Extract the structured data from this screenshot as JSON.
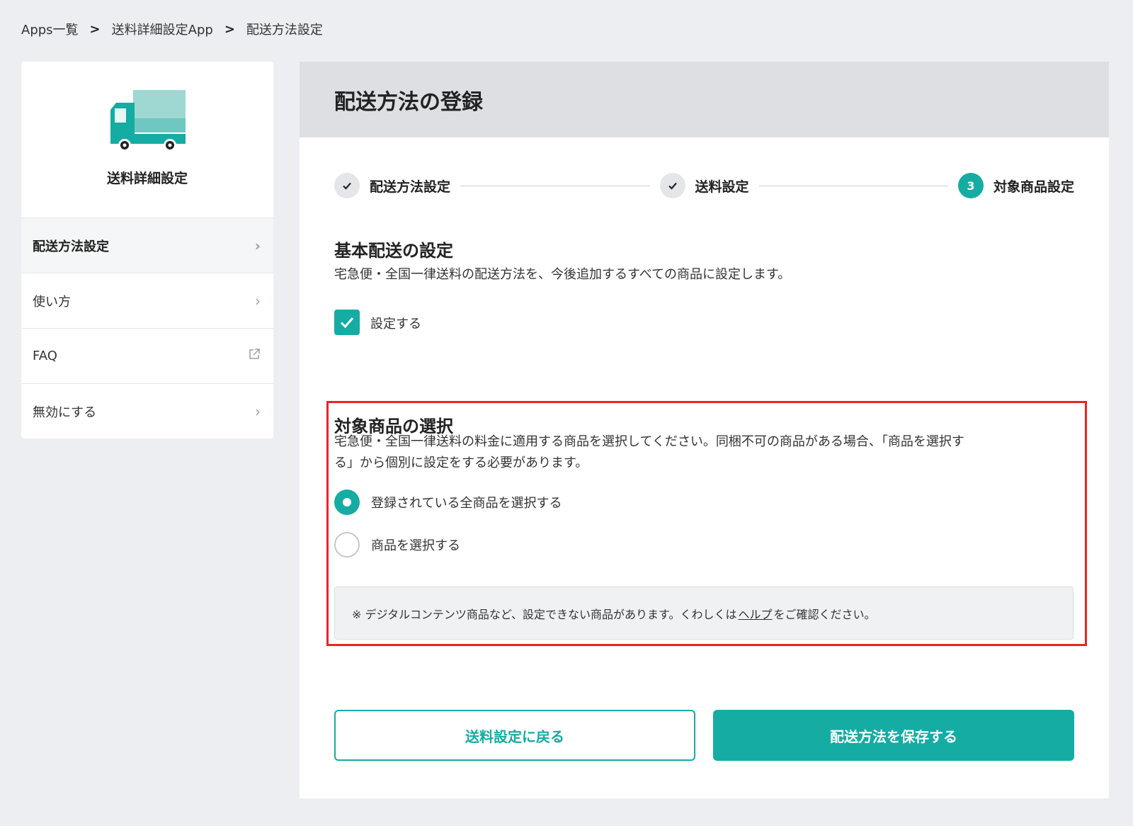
{
  "breadcrumb": {
    "items": [
      "Apps一覧",
      "送料詳細設定App",
      "配送方法設定"
    ],
    "separator": ">"
  },
  "sidebar": {
    "app_title": "送料詳細設定",
    "icon": "truck-icon",
    "items": [
      {
        "label": "配送方法設定",
        "icon": "chevron-right-icon",
        "active": true
      },
      {
        "label": "使い方",
        "icon": "chevron-right-icon",
        "active": false
      },
      {
        "label": "FAQ",
        "icon": "external-link-icon",
        "active": false
      },
      {
        "label": "無効にする",
        "icon": "chevron-right-icon",
        "active": false
      }
    ]
  },
  "main": {
    "title": "配送方法の登録",
    "steps": [
      {
        "label": "配送方法設定",
        "state": "done"
      },
      {
        "label": "送料設定",
        "state": "done"
      },
      {
        "label": "対象商品設定",
        "state": "current",
        "number": "3"
      }
    ],
    "basic": {
      "title": "基本配送の設定",
      "description": "宅急便・全国一律送料の配送方法を、今後追加するすべての商品に設定します。",
      "checkbox_label": "設定する",
      "checked": true
    },
    "target": {
      "title": "対象商品の選択",
      "description_line1": "宅急便・全国一律送料の料金に適用する商品を選択してください。同梱不可の商品がある場合、「商品を選択す",
      "description_line2": "る」から個別に設定をする必要があります。",
      "options": [
        {
          "label": "登録されている全商品を選択する",
          "selected": true
        },
        {
          "label": "商品を選択する",
          "selected": false
        }
      ],
      "note_prefix": "※ デジタルコンテンツ商品など、設定できない商品があります。くわしくは",
      "note_link": "ヘルプ",
      "note_suffix": "をご確認ください。"
    },
    "buttons": {
      "back": "送料設定に戻る",
      "save": "配送方法を保存する"
    }
  },
  "colors": {
    "accent": "#14aca3",
    "highlight_border": "#e8261f"
  }
}
